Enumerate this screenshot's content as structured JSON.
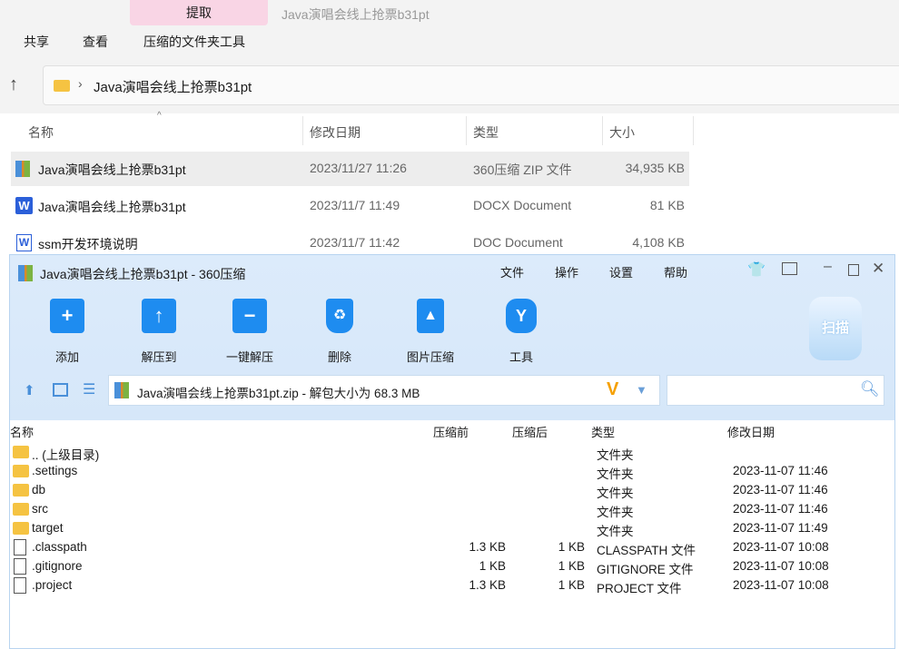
{
  "explorer": {
    "context_tab": "提取",
    "window_title": "Java演唱会线上抢票b31pt",
    "ribbon": [
      "共享",
      "查看",
      "压缩的文件夹工具"
    ],
    "breadcrumb": "Java演唱会线上抢票b31pt",
    "columns": [
      "名称",
      "修改日期",
      "类型",
      "大小"
    ],
    "files": [
      {
        "name": "Java演唱会线上抢票b31pt",
        "date": "2023/11/27 11:26",
        "type": "360压缩 ZIP 文件",
        "size": "34,935 KB",
        "icon": "zip-icon"
      },
      {
        "name": "Java演唱会线上抢票b31pt",
        "date": "2023/11/7 11:49",
        "type": "DOCX Document",
        "size": "81 KB",
        "icon": "word-icon"
      },
      {
        "name": "ssm开发环境说明",
        "date": "2023/11/7 11:42",
        "type": "DOC Document",
        "size": "4,108 KB",
        "icon": "word-icon"
      }
    ]
  },
  "zipapp": {
    "title": "Java演唱会线上抢票b31pt - 360压缩",
    "menu": [
      "文件",
      "操作",
      "设置",
      "帮助"
    ],
    "toolbar": [
      "添加",
      "解压到",
      "一键解压",
      "删除",
      "图片压缩",
      "工具"
    ],
    "scan": "扫描",
    "path": "Java演唱会线上抢票b31pt.zip - 解包大小为 68.3 MB",
    "columns": [
      "名称",
      "压缩前",
      "压缩后",
      "类型",
      "修改日期"
    ],
    "rows": [
      {
        "name": ".. (上级目录)",
        "before": "",
        "after": "",
        "type": "文件夹",
        "date": "",
        "folder": true
      },
      {
        "name": ".settings",
        "before": "",
        "after": "",
        "type": "文件夹",
        "date": "2023-11-07 11:46",
        "folder": true
      },
      {
        "name": "db",
        "before": "",
        "after": "",
        "type": "文件夹",
        "date": "2023-11-07 11:46",
        "folder": true
      },
      {
        "name": "src",
        "before": "",
        "after": "",
        "type": "文件夹",
        "date": "2023-11-07 11:46",
        "folder": true
      },
      {
        "name": "target",
        "before": "",
        "after": "",
        "type": "文件夹",
        "date": "2023-11-07 11:49",
        "folder": true
      },
      {
        "name": ".classpath",
        "before": "1.3 KB",
        "after": "1 KB",
        "type": "CLASSPATH 文件",
        "date": "2023-11-07 10:08",
        "folder": false
      },
      {
        "name": ".gitignore",
        "before": "1 KB",
        "after": "1 KB",
        "type": "GITIGNORE 文件",
        "date": "2023-11-07 10:08",
        "folder": false
      },
      {
        "name": ".project",
        "before": "1.3 KB",
        "after": "1 KB",
        "type": "PROJECT 文件",
        "date": "2023-11-07 10:08",
        "folder": false
      }
    ]
  }
}
